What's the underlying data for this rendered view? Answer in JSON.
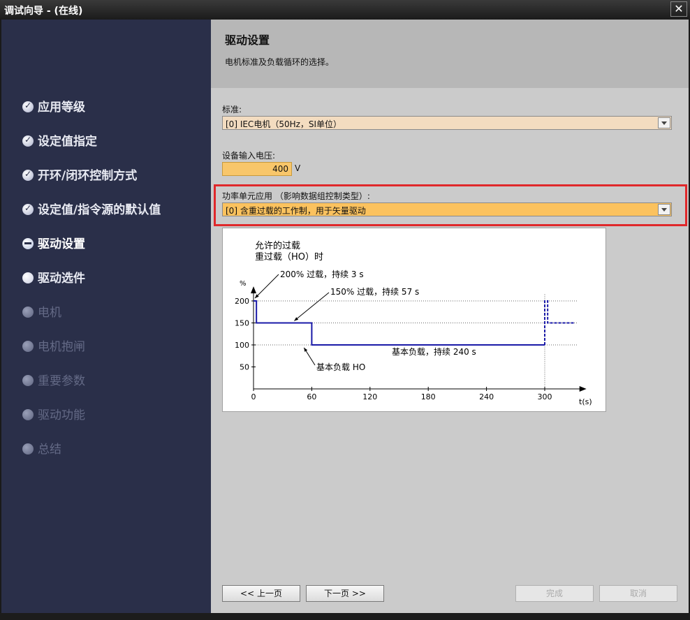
{
  "window": {
    "title": "调试向导 - (在线)",
    "close_label": "✕"
  },
  "sidebar": {
    "items": [
      {
        "label": "应用等级",
        "state": "done"
      },
      {
        "label": "设定值指定",
        "state": "done"
      },
      {
        "label": "开环/闭环控制方式",
        "state": "done"
      },
      {
        "label": "设定值/指令源的默认值",
        "state": "done"
      },
      {
        "label": "驱动设置",
        "state": "current"
      },
      {
        "label": "驱动选件",
        "state": "next"
      },
      {
        "label": "电机",
        "state": "disabled"
      },
      {
        "label": "电机抱闸",
        "state": "disabled"
      },
      {
        "label": "重要参数",
        "state": "disabled"
      },
      {
        "label": "驱动功能",
        "state": "disabled"
      },
      {
        "label": "总结",
        "state": "disabled"
      }
    ]
  },
  "header": {
    "title": "驱动设置",
    "description": "电机标准及负载循环的选择。"
  },
  "form": {
    "standard_label": "标准:",
    "standard_value": "[0] IEC电机（50Hz，SI单位）",
    "voltage_label": "设备输入电压:",
    "voltage_value": "400",
    "voltage_unit": "V",
    "power_label": "功率单元应用 （影响数据组控制类型）:",
    "power_value": "[0] 含重过载的工作制，用于矢量驱动"
  },
  "chart_data": {
    "type": "line",
    "title": "允许的过载",
    "subtitle": "重过载（HO）时",
    "ylabel": "%",
    "xlabel": "t(s)",
    "xticks": [
      0,
      60,
      120,
      180,
      240,
      300
    ],
    "yticks": [
      50,
      100,
      150,
      200
    ],
    "xlim": [
      0,
      330
    ],
    "ylim": [
      0,
      230
    ],
    "series": [
      {
        "x": [
          0,
          3,
          3,
          60,
          60,
          300
        ],
        "y": [
          200,
          200,
          150,
          150,
          100,
          100
        ],
        "style": "solid"
      },
      {
        "x": [
          300,
          300,
          303,
          303,
          330
        ],
        "y": [
          100,
          200,
          200,
          150,
          150
        ],
        "style": "dashed"
      }
    ],
    "reference_lines": [
      200,
      150,
      100
    ],
    "annotations": {
      "overload200": "200% 过载，持续 3 s",
      "overload150": "150% 过载，持续 57 s",
      "base_ho": "基本负载 HO",
      "base240": "基本负载，持续 240 s"
    },
    "color": "#1a1aa8"
  },
  "footer": {
    "prev": "<< 上一页",
    "next": "下一页 >>",
    "finish": "完成",
    "cancel": "取消"
  }
}
